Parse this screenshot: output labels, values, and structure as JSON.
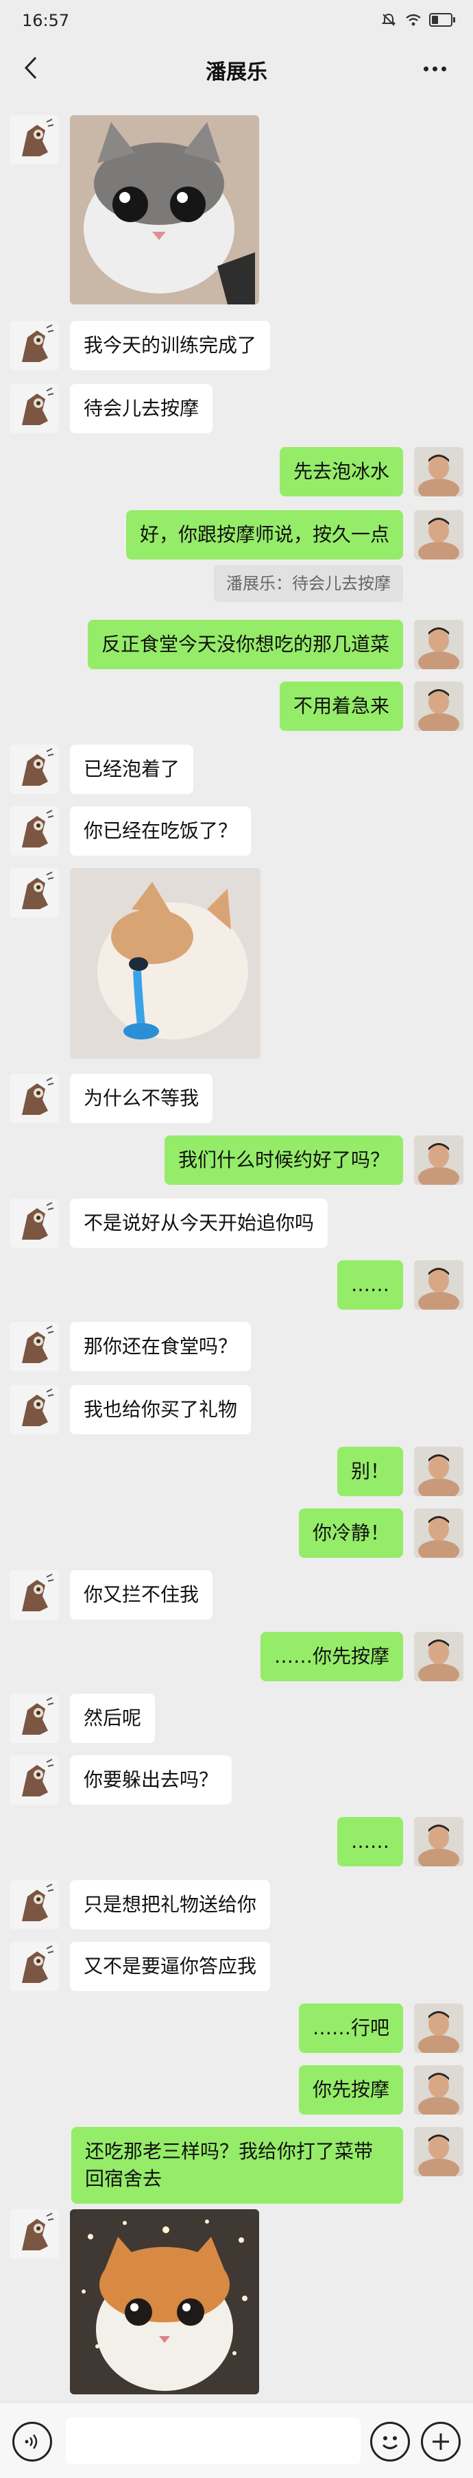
{
  "status_bar": {
    "time": "16:57",
    "battery_level": 0.35
  },
  "header": {
    "title": "潘展乐"
  },
  "messages": [
    {
      "side": "left",
      "type": "sticker",
      "sticker": "kitten-sticker-icon"
    },
    {
      "side": "left",
      "type": "text",
      "text": "我今天的训练完成了"
    },
    {
      "side": "left",
      "type": "text",
      "text": "待会儿去按摩"
    },
    {
      "side": "right",
      "type": "text",
      "text": "先去泡冰水"
    },
    {
      "side": "right",
      "type": "text",
      "text": "好，你跟按摩师说，按久一点",
      "quote": "潘展乐：待会儿去按摩"
    },
    {
      "side": "right",
      "type": "text",
      "text": "反正食堂今天没你想吃的那几道菜"
    },
    {
      "side": "right",
      "type": "text",
      "text": "不用着急来"
    },
    {
      "side": "left",
      "type": "text",
      "text": "已经泡着了"
    },
    {
      "side": "left",
      "type": "text",
      "text": "你已经在吃饭了？"
    },
    {
      "side": "left",
      "type": "sticker",
      "sticker": "crying-cat-sticker-icon"
    },
    {
      "side": "left",
      "type": "text",
      "text": "为什么不等我"
    },
    {
      "side": "right",
      "type": "text",
      "text": "我们什么时候约好了吗？"
    },
    {
      "side": "left",
      "type": "text",
      "text": "不是说好从今天开始追你吗"
    },
    {
      "side": "right",
      "type": "text",
      "text": "……"
    },
    {
      "side": "left",
      "type": "text",
      "text": "那你还在食堂吗？"
    },
    {
      "side": "left",
      "type": "text",
      "text": "我也给你买了礼物"
    },
    {
      "side": "right",
      "type": "text",
      "text": "别！"
    },
    {
      "side": "right",
      "type": "text",
      "text": "你冷静！"
    },
    {
      "side": "left",
      "type": "text",
      "text": "你又拦不住我"
    },
    {
      "side": "right",
      "type": "text",
      "text": "……你先按摩"
    },
    {
      "side": "left",
      "type": "text",
      "text": "然后呢"
    },
    {
      "side": "left",
      "type": "text",
      "text": "你要躲出去吗？"
    },
    {
      "side": "right",
      "type": "text",
      "text": "……"
    },
    {
      "side": "left",
      "type": "text",
      "text": "只是想把礼物送给你"
    },
    {
      "side": "left",
      "type": "text",
      "text": "又不是要逼你答应我"
    },
    {
      "side": "right",
      "type": "text",
      "text": "……行吧"
    },
    {
      "side": "right",
      "type": "text",
      "text": "你先按摩"
    },
    {
      "side": "right",
      "type": "text",
      "text": "还吃那老三样吗？我给你打了菜带回宿舍去"
    },
    {
      "side": "left",
      "type": "sticker",
      "sticker": "sparkle-cat-sticker-icon"
    }
  ],
  "input": {
    "placeholder": ""
  },
  "colors": {
    "background": "#ededed",
    "bubble_mine": "#95ec69",
    "bubble_theirs": "#ffffff"
  }
}
